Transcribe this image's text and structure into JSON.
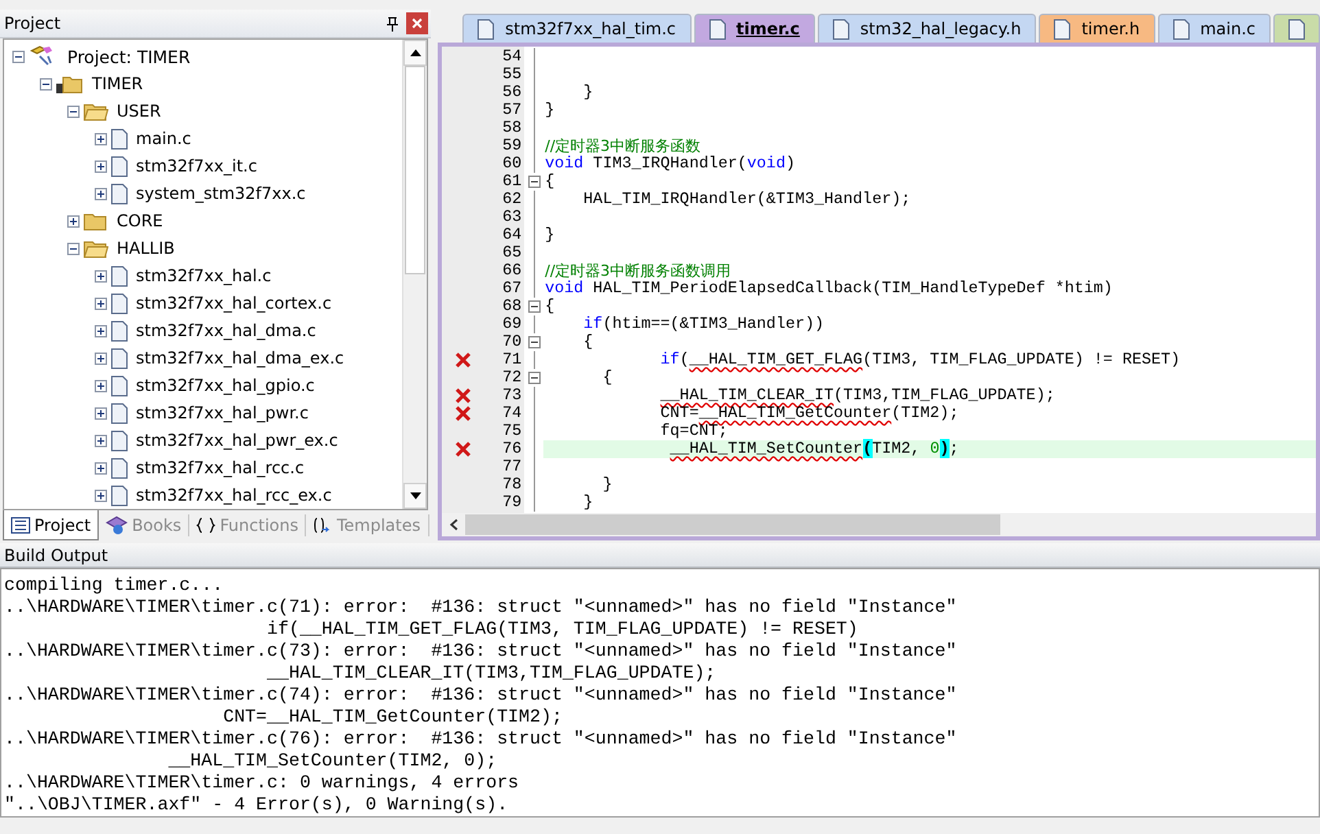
{
  "project_panel": {
    "title": "Project",
    "tree": [
      {
        "label": "Project: TIMER",
        "kind": "project",
        "expanded": true,
        "children": [
          {
            "label": "TIMER",
            "kind": "target",
            "expanded": true,
            "children": [
              {
                "label": "USER",
                "kind": "folder",
                "expanded": true,
                "children": [
                  {
                    "label": "main.c",
                    "kind": "file",
                    "expanded": false
                  },
                  {
                    "label": "stm32f7xx_it.c",
                    "kind": "file",
                    "expanded": false
                  },
                  {
                    "label": "system_stm32f7xx.c",
                    "kind": "file",
                    "expanded": false
                  }
                ]
              },
              {
                "label": "CORE",
                "kind": "folder",
                "expanded": false
              },
              {
                "label": "HALLIB",
                "kind": "folder",
                "expanded": true,
                "children": [
                  {
                    "label": "stm32f7xx_hal.c",
                    "kind": "file",
                    "expanded": false
                  },
                  {
                    "label": "stm32f7xx_hal_cortex.c",
                    "kind": "file",
                    "expanded": false
                  },
                  {
                    "label": "stm32f7xx_hal_dma.c",
                    "kind": "file",
                    "expanded": false
                  },
                  {
                    "label": "stm32f7xx_hal_dma_ex.c",
                    "kind": "file",
                    "expanded": false
                  },
                  {
                    "label": "stm32f7xx_hal_gpio.c",
                    "kind": "file",
                    "expanded": false
                  },
                  {
                    "label": "stm32f7xx_hal_pwr.c",
                    "kind": "file",
                    "expanded": false
                  },
                  {
                    "label": "stm32f7xx_hal_pwr_ex.c",
                    "kind": "file",
                    "expanded": false
                  },
                  {
                    "label": "stm32f7xx_hal_rcc.c",
                    "kind": "file",
                    "expanded": false
                  },
                  {
                    "label": "stm32f7xx_hal_rcc_ex.c",
                    "kind": "file",
                    "expanded": false
                  }
                ]
              }
            ]
          }
        ]
      }
    ],
    "tabs": [
      {
        "label": "Project",
        "kind": "project",
        "selected": true
      },
      {
        "label": "Books",
        "kind": "books",
        "selected": false
      },
      {
        "label": "Functions",
        "kind": "functions",
        "selected": false
      },
      {
        "label": "Templates",
        "kind": "templates",
        "selected": false
      }
    ]
  },
  "editor": {
    "tabs": [
      {
        "label": "stm32f7xx_hal_tim.c",
        "color": "#c4d7f2",
        "selected": false
      },
      {
        "label": "timer.c",
        "color": "#c2a8e0",
        "selected": true
      },
      {
        "label": "stm32_hal_legacy.h",
        "color": "#c4d7f2",
        "selected": false
      },
      {
        "label": "timer.h",
        "color": "#f7b982",
        "selected": false
      },
      {
        "label": "main.c",
        "color": "#c4d7f2",
        "selected": false
      },
      {
        "color": "#c9dca8",
        "selected": false
      }
    ],
    "lines": [
      {
        "number": "54",
        "error": false,
        "foldable": false,
        "current": false
      },
      {
        "number": "55",
        "error": false,
        "foldable": false,
        "current": false
      },
      {
        "number": "56",
        "error": false,
        "foldable": false,
        "current": false,
        "segments": [
          {
            "kind": "plain",
            "text": "    }"
          }
        ]
      },
      {
        "number": "57",
        "error": false,
        "foldable": false,
        "current": false,
        "segments": [
          {
            "kind": "plain",
            "text": "}"
          }
        ]
      },
      {
        "number": "58",
        "error": false,
        "foldable": false,
        "current": false
      },
      {
        "number": "59",
        "error": false,
        "foldable": false,
        "current": false,
        "segments": [
          {
            "kind": "comment",
            "text": "//定时器3中断服务函数"
          }
        ]
      },
      {
        "number": "60",
        "error": false,
        "foldable": false,
        "current": false,
        "segments": [
          {
            "kind": "keyword",
            "text": "void"
          },
          {
            "kind": "plain",
            "text": " TIM3_IRQHandler("
          },
          {
            "kind": "keyword",
            "text": "void"
          },
          {
            "kind": "plain",
            "text": ")"
          }
        ]
      },
      {
        "number": "61",
        "error": false,
        "foldable": true,
        "current": false,
        "segments": [
          {
            "kind": "plain",
            "text": "{"
          }
        ]
      },
      {
        "number": "62",
        "error": false,
        "foldable": false,
        "current": false,
        "segments": [
          {
            "kind": "plain",
            "text": "    HAL_TIM_IRQHandler(&TIM3_Handler);"
          }
        ]
      },
      {
        "number": "63",
        "error": false,
        "foldable": false,
        "current": false
      },
      {
        "number": "64",
        "error": false,
        "foldable": false,
        "current": false,
        "segments": [
          {
            "kind": "plain",
            "text": "}"
          }
        ]
      },
      {
        "number": "65",
        "error": false,
        "foldable": false,
        "current": false
      },
      {
        "number": "66",
        "error": false,
        "foldable": false,
        "current": false,
        "segments": [
          {
            "kind": "comment",
            "text": "//定时器3中断服务函数调用"
          }
        ]
      },
      {
        "number": "67",
        "error": false,
        "foldable": false,
        "current": false,
        "segments": [
          {
            "kind": "keyword",
            "text": "void"
          },
          {
            "kind": "plain",
            "text": " HAL_TIM_PeriodElapsedCallback(TIM_HandleTypeDef *htim)"
          }
        ]
      },
      {
        "number": "68",
        "error": false,
        "foldable": true,
        "current": false,
        "segments": [
          {
            "kind": "plain",
            "text": "{"
          }
        ]
      },
      {
        "number": "69",
        "error": false,
        "foldable": false,
        "current": false,
        "segments": [
          {
            "kind": "keyword",
            "text": "    if"
          },
          {
            "kind": "plain",
            "text": "(htim==(&TIM3_Handler))"
          }
        ]
      },
      {
        "number": "70",
        "error": false,
        "foldable": true,
        "current": false,
        "segments": [
          {
            "kind": "plain",
            "text": "    {"
          }
        ]
      },
      {
        "number": "71",
        "error": true,
        "foldable": false,
        "current": false,
        "segments": [
          {
            "kind": "keyword",
            "text": "            if"
          },
          {
            "kind": "plain",
            "text": "("
          },
          {
            "kind": "error",
            "text": "__HAL_TIM_GET_FLAG"
          },
          {
            "kind": "plain",
            "text": "(TIM3, TIM_FLAG_UPDATE) != RESET)"
          }
        ]
      },
      {
        "number": "72",
        "error": false,
        "foldable": true,
        "current": false,
        "segments": [
          {
            "kind": "plain",
            "text": "      {"
          }
        ]
      },
      {
        "number": "73",
        "error": true,
        "foldable": false,
        "current": false,
        "segments": [
          {
            "kind": "error_indented",
            "text": "            __HAL_TIM_CLEAR_IT"
          },
          {
            "kind": "plain",
            "text": "(TIM3,TIM_FLAG_UPDATE);"
          }
        ]
      },
      {
        "number": "74",
        "error": true,
        "foldable": false,
        "current": false,
        "segments": [
          {
            "kind": "plain",
            "text": "            CNT="
          },
          {
            "kind": "error",
            "text": "__HAL_TIM_GetCounter"
          },
          {
            "kind": "plain",
            "text": "(TIM2);"
          }
        ]
      },
      {
        "number": "75",
        "error": false,
        "foldable": false,
        "current": false,
        "segments": [
          {
            "kind": "plain",
            "text": "            fq=CNT;"
          }
        ]
      },
      {
        "number": "76",
        "error": true,
        "foldable": false,
        "current": true,
        "segments": [
          {
            "kind": "error_indented",
            "text": "             __HAL_TIM_SetCounter"
          },
          {
            "kind": "brace",
            "text": "("
          },
          {
            "kind": "plain",
            "text": "TIM2, "
          },
          {
            "kind": "number",
            "text": "0"
          },
          {
            "kind": "brace",
            "text": ")"
          },
          {
            "kind": "plain",
            "text": ";"
          }
        ]
      },
      {
        "number": "77",
        "error": false,
        "foldable": false,
        "current": false
      },
      {
        "number": "78",
        "error": false,
        "foldable": false,
        "current": false,
        "segments": [
          {
            "kind": "plain",
            "text": "      }"
          }
        ]
      },
      {
        "number": "79",
        "error": false,
        "foldable": false,
        "current": false,
        "segments": [
          {
            "kind": "plain",
            "text": "    }"
          }
        ]
      }
    ]
  },
  "build_output": {
    "title": "Build Output",
    "lines": [
      "compiling timer.c...",
      "..\\HARDWARE\\TIMER\\timer.c(71): error:  #136: struct \"<unnamed>\" has no field \"Instance\"",
      "                        if(__HAL_TIM_GET_FLAG(TIM3, TIM_FLAG_UPDATE) != RESET)",
      "..\\HARDWARE\\TIMER\\timer.c(73): error:  #136: struct \"<unnamed>\" has no field \"Instance\"",
      "                        __HAL_TIM_CLEAR_IT(TIM3,TIM_FLAG_UPDATE);",
      "..\\HARDWARE\\TIMER\\timer.c(74): error:  #136: struct \"<unnamed>\" has no field \"Instance\"",
      "                    CNT=__HAL_TIM_GetCounter(TIM2);",
      "..\\HARDWARE\\TIMER\\timer.c(76): error:  #136: struct \"<unnamed>\" has no field \"Instance\"",
      "               __HAL_TIM_SetCounter(TIM2, 0);",
      "..\\HARDWARE\\TIMER\\timer.c: 0 warnings, 4 errors",
      "\"..\\OBJ\\TIMER.axf\" - 4 Error(s), 0 Warning(s)."
    ]
  }
}
